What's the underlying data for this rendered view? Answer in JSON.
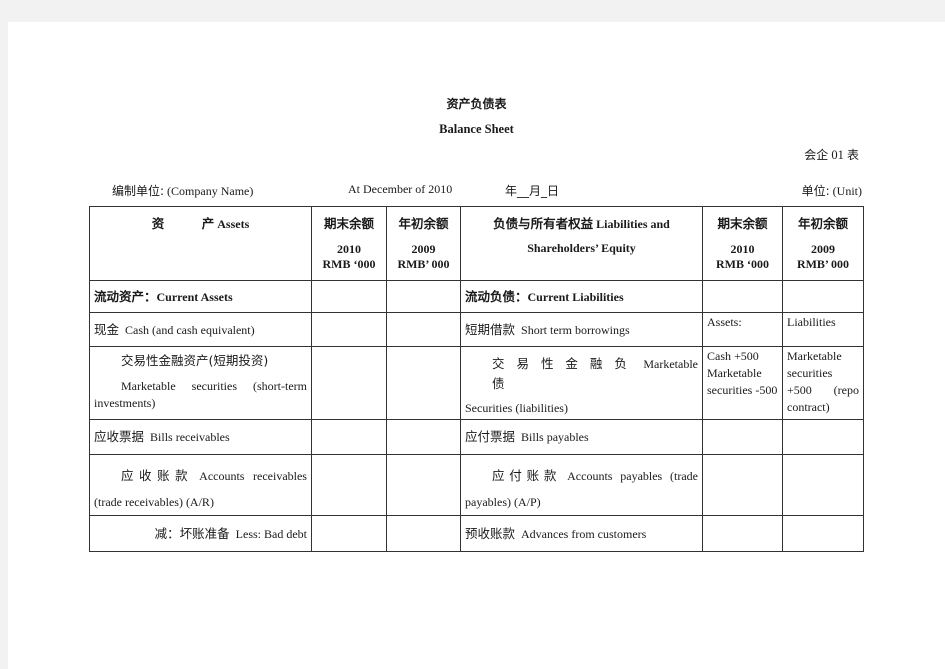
{
  "document": {
    "title_cn": "资产负债表",
    "title_en": "Balance Sheet",
    "form_code_cn1": "会企",
    "form_code_num": "01",
    "form_code_cn2": "表",
    "company_label_cn": "编制单位:",
    "company_label_en": "(Company Name)",
    "date_en": "At December of 2010",
    "date_cn": "年__月_日",
    "unit_label_cn": "单位:",
    "unit_label_en": "(Unit)"
  },
  "table": {
    "header": {
      "assets_cn": "资　　　产",
      "assets_en": "Assets",
      "end_balance_cn": "期末余额",
      "end_year": "2010",
      "end_currency": "RMB ‘000",
      "begin_balance_cn": "年初余额",
      "begin_year": "2009",
      "begin_currency": "RMB’ 000",
      "liab_cn": "负债与所有者权益",
      "liab_en_1": "Liabilities and",
      "liab_en_2": "Shareholders’ Equity"
    },
    "sections": {
      "current_assets_cn": "流动资产：",
      "current_assets_en": "Current Assets",
      "current_liab_cn": "流动负债：",
      "current_liab_en": "Current Liabilities"
    },
    "rows": [
      {
        "asset_cn": "现金",
        "asset_en": "Cash (and cash equivalent)",
        "liab_cn": "短期借款",
        "liab_en": "Short term borrowings",
        "liab_end": "Assets:",
        "liab_begin": "Liabilities"
      },
      {
        "asset_cn": "交易性金融资产(短期投资)",
        "asset_en": "Marketable securities (short-term investments)",
        "liab_cn": "交 易 性 金 融 负 债",
        "liab_en": "Marketable Securities (liabilities)",
        "liab_end": "Cash +500 Marketable securities -500",
        "liab_begin": "Marketable securities +500 (repo contract)"
      },
      {
        "asset_cn": "应收票据",
        "asset_en": "Bills receivables",
        "liab_cn": "应付票据",
        "liab_en": "Bills payables",
        "liab_end": "",
        "liab_begin": ""
      },
      {
        "asset_cn": "应收账款",
        "asset_en": "Accounts receivables (trade receivables) (A/R)",
        "liab_cn": "应付账款",
        "liab_en": "Accounts payables (trade payables) (A/P)",
        "liab_end": "",
        "liab_begin": ""
      },
      {
        "asset_cn": "减：坏账准备",
        "asset_en": "Less: Bad debt",
        "liab_cn": "预收账款",
        "liab_en": "Advances from customers",
        "liab_end": "",
        "liab_begin": ""
      }
    ]
  }
}
